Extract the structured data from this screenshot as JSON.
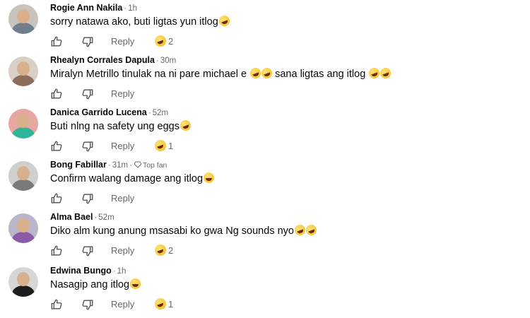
{
  "comments": [
    {
      "name": "Rogie Ann Nakila",
      "time": "1h",
      "text": "sorry natawa ako, buti ligtas yun itlog",
      "emojis": [
        "laugh"
      ],
      "reply": "Reply",
      "reaction_count": "2",
      "avatar_colors": {
        "bg": "#c9c3bd",
        "body": "#6f7d8c"
      }
    },
    {
      "name": "Rhealyn Corrales Dapula",
      "time": "30m",
      "text": "Miralyn Metrillo tinulak na ni pare michael e",
      "mid_emojis": [
        "laugh",
        "laugh"
      ],
      "text2": "sana ligtas ang itlog",
      "emojis": [
        "laugh",
        "laugh"
      ],
      "reply": "Reply",
      "reaction_count": "",
      "avatar_colors": {
        "bg": "#d8cfc5",
        "body": "#8a6d5a"
      }
    },
    {
      "name": "Danica Garrido Lucena",
      "time": "52m",
      "text": "Buti nlng na safety ung eggs",
      "emojis": [
        "laugh"
      ],
      "reply": "Reply",
      "reaction_count": "1",
      "avatar_colors": {
        "bg": "#e8a6a0",
        "body": "#2fb59a"
      }
    },
    {
      "name": "Bong Fabillar",
      "time": "31m",
      "badge": "Top fan",
      "text": "Confirm walang damage ang itlog",
      "emojis": [
        "smile"
      ],
      "reply": "Reply",
      "reaction_count": "",
      "avatar_colors": {
        "bg": "#cfcfcf",
        "body": "#7a7a7a"
      }
    },
    {
      "name": "Alma Bael",
      "time": "52m",
      "text": "Diko alm kung anung msasabi ko gwa Ng sounds nyo",
      "emojis": [
        "laugh",
        "laugh"
      ],
      "reply": "Reply",
      "reaction_count": "2",
      "avatar_colors": {
        "bg": "#b9b6c9",
        "body": "#8b5aa8"
      }
    },
    {
      "name": "Edwina Bungo",
      "time": "1h",
      "text": "Nasagip ang itlog",
      "emojis": [
        "smile"
      ],
      "reply": "Reply",
      "reaction_count": "1",
      "avatar_colors": {
        "bg": "#d6d6d6",
        "body": "#1d1d1d"
      }
    }
  ],
  "icons": {
    "like": "thumbs-up-icon",
    "dislike": "thumbs-down-icon",
    "reaction": "laughing-emoji-icon",
    "badge": "diamond-icon"
  },
  "colors": {
    "text": "#050505",
    "meta": "#65676b",
    "emoji": "#f2b81a"
  }
}
